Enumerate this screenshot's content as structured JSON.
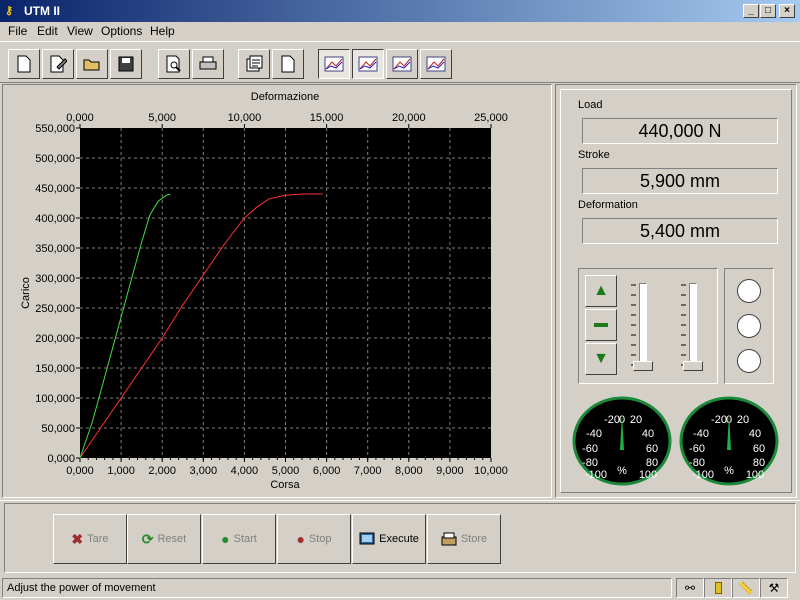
{
  "window": {
    "title": "UTM II"
  },
  "menu": [
    {
      "label": "File",
      "key": "F"
    },
    {
      "label": "Edit",
      "key": "E"
    },
    {
      "label": "View",
      "key": "V"
    },
    {
      "label": "Options",
      "key": "O"
    },
    {
      "label": "Help",
      "key": "H"
    }
  ],
  "toolbar": {
    "buttons": [
      {
        "name": "new-document",
        "icon": "new-document-icon"
      },
      {
        "name": "edit-document",
        "icon": "edit-document-icon"
      },
      {
        "name": "open-folder",
        "icon": "folder-open-icon"
      },
      {
        "name": "save",
        "icon": "floppy-disk-icon"
      },
      {
        "name": "print-preview",
        "icon": "print-preview-icon"
      },
      {
        "name": "print",
        "icon": "printer-icon"
      },
      {
        "name": "properties",
        "icon": "properties-icon"
      },
      {
        "name": "blank-page",
        "icon": "page-icon"
      },
      {
        "name": "graph-1",
        "icon": "graph-icon"
      },
      {
        "name": "graph-2",
        "icon": "graph-icon"
      },
      {
        "name": "graph-3",
        "icon": "graph-icon"
      },
      {
        "name": "graph-4",
        "icon": "graph-icon"
      }
    ]
  },
  "readouts": {
    "load_label": "Load",
    "load_value": "440,000 N",
    "stroke_label": "Stroke",
    "stroke_value": "5,900 mm",
    "deformation_label": "Deformation",
    "deformation_value": "5,400 mm"
  },
  "gauges": {
    "ticks": [
      "-20",
      "0",
      "20",
      "-40",
      "40",
      "-60",
      "60",
      "-80",
      "80",
      "-100",
      "%",
      "100"
    ],
    "left_value_pct": 0,
    "right_value_pct": 0
  },
  "actions": {
    "tare": "Tare",
    "reset": "Reset",
    "start": "Start",
    "stop": "Stop",
    "execute": "Execute",
    "store": "Store"
  },
  "status": {
    "message": "Adjust the power of movement"
  },
  "chart_data": {
    "type": "line",
    "x_bottom_label": "Corsa",
    "x_top_label": "Deformazione",
    "ylabel": "Carico",
    "x_bottom_range": [
      0,
      10
    ],
    "x_top_range": [
      0,
      25
    ],
    "ylim": [
      0,
      550000
    ],
    "x_bottom_ticks": [
      "0,000",
      "1,000",
      "2,000",
      "3,000",
      "4,000",
      "5,000",
      "6,000",
      "7,000",
      "8,000",
      "9,000",
      "10,000"
    ],
    "x_top_ticks": [
      "0,000",
      "5,000",
      "10,000",
      "15,000",
      "20,000",
      "25,000"
    ],
    "y_ticks": [
      "0,000",
      "50,000",
      "100,000",
      "150,000",
      "200,000",
      "250,000",
      "300,000",
      "350,000",
      "400,000",
      "450,000",
      "500,000",
      "550,000"
    ],
    "grid": true,
    "background": "#000000",
    "series": [
      {
        "color": "#ff3030",
        "axis": "bottom",
        "x": [
          0,
          0.5,
          1.0,
          1.5,
          2.0,
          2.5,
          3.0,
          3.5,
          4.0,
          4.3,
          4.6,
          5.0,
          5.4,
          5.9
        ],
        "y": [
          0,
          50000,
          100000,
          150000,
          200000,
          255000,
          305000,
          355000,
          400000,
          418000,
          432000,
          438000,
          440000,
          440000
        ]
      },
      {
        "color": "#40e040",
        "axis": "bottom",
        "x": [
          0,
          0.3,
          0.6,
          0.9,
          1.2,
          1.5,
          1.7,
          1.9,
          2.1,
          2.2
        ],
        "y": [
          0,
          60000,
          135000,
          210000,
          285000,
          360000,
          405000,
          428000,
          438000,
          440000
        ]
      }
    ]
  }
}
